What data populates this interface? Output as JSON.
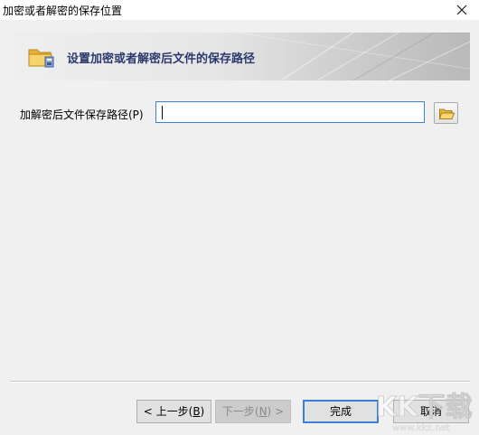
{
  "window": {
    "title": "加密或者解密的保存位置"
  },
  "banner": {
    "heading": "设置加密或者解密后文件的保存路径"
  },
  "form": {
    "path_label": "加解密后文件保存路径(P)",
    "path_value": ""
  },
  "buttons": {
    "prev_label_main": "< 上一步(",
    "prev_hotkey": "B",
    "prev_label_end": ")",
    "next_label_main": "下一步(",
    "next_hotkey": "N",
    "next_label_end": ") >",
    "finish_label": "完成",
    "cancel_label": "取消"
  },
  "watermark": {
    "brand": "KK下载",
    "url": "www.kkx.net"
  },
  "colors": {
    "accent": "#3c7fd6",
    "banner_text": "#2b3a6d",
    "folder": "#f2c34a"
  }
}
